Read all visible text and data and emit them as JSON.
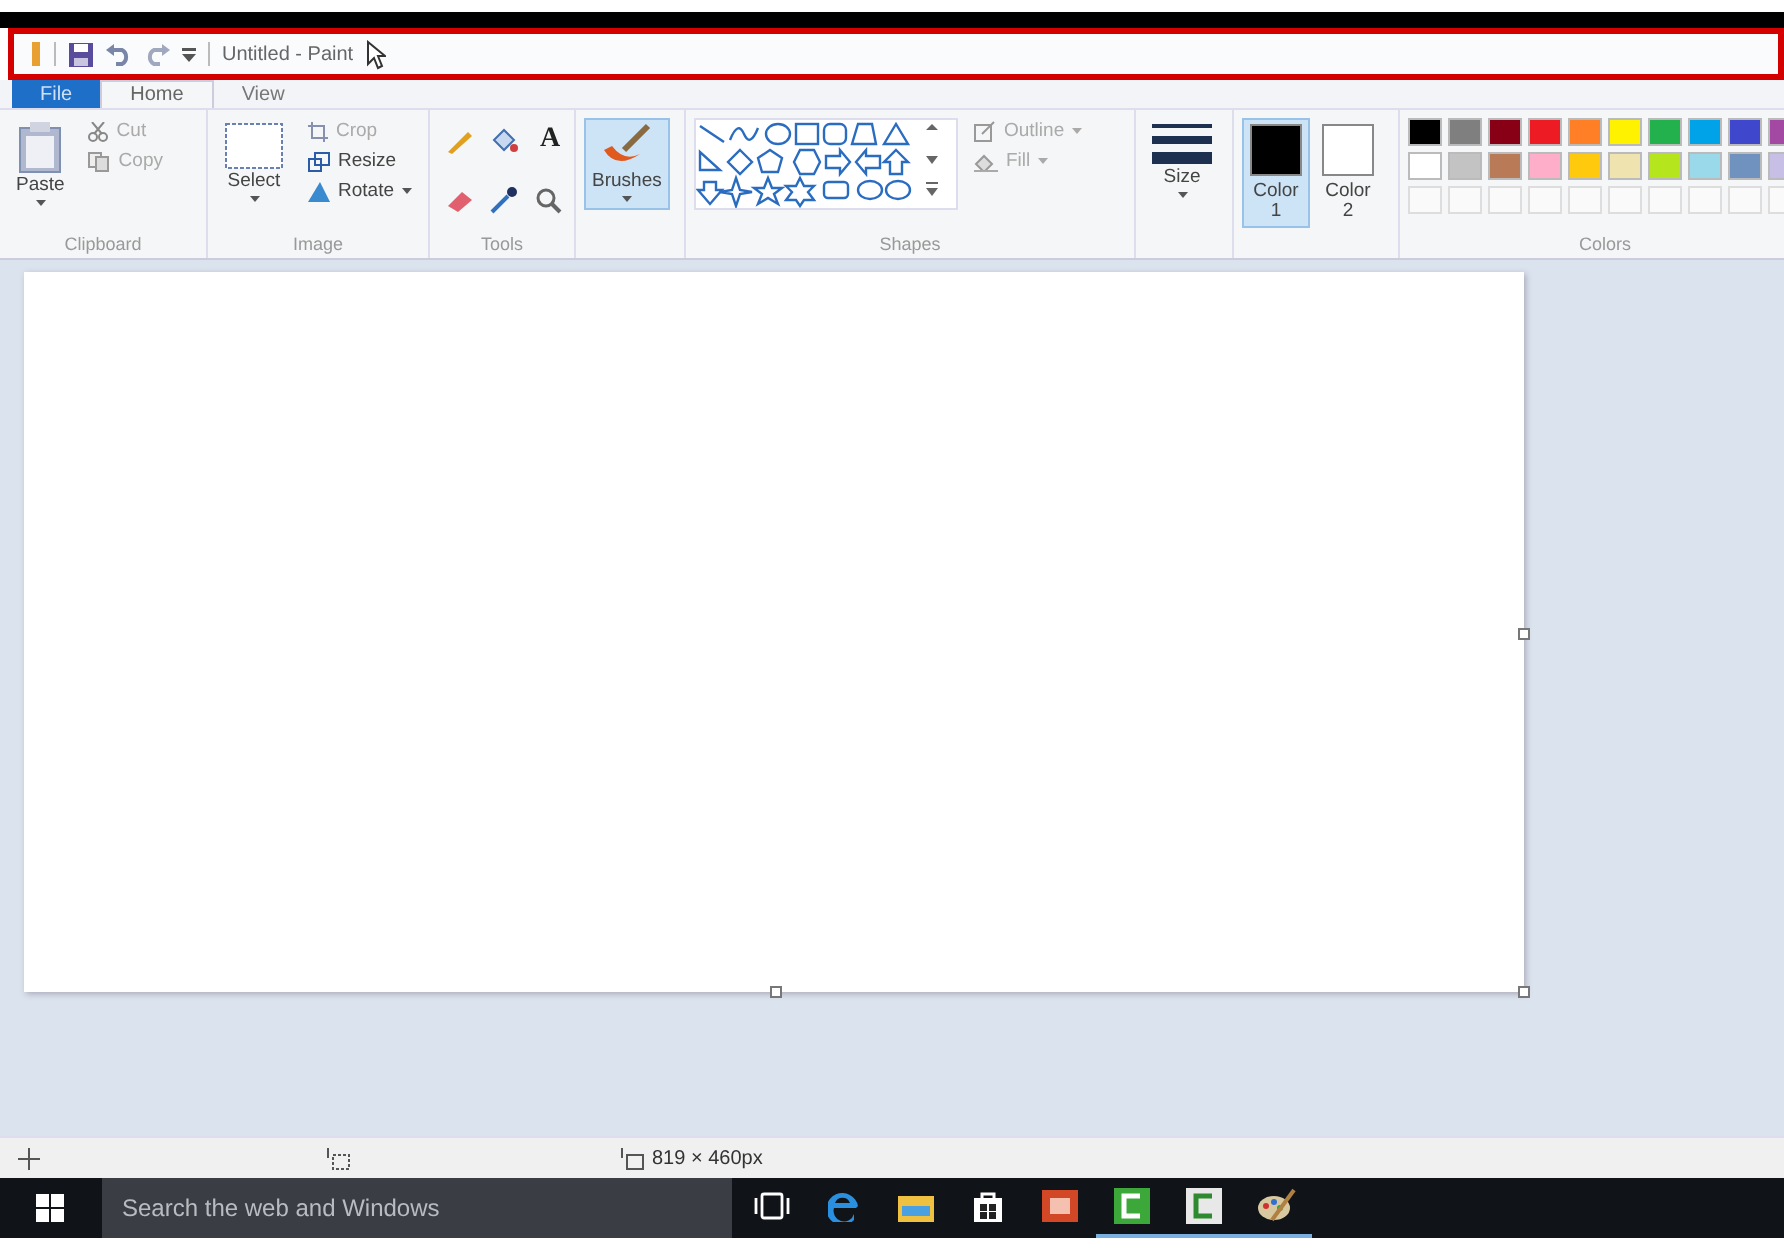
{
  "title_bar": {
    "title": "Untitled - Paint",
    "highlighted": true
  },
  "tabs": [
    {
      "label": "File",
      "selected": false,
      "kind": "file"
    },
    {
      "label": "Home",
      "selected": true,
      "kind": "tab"
    },
    {
      "label": "View",
      "selected": false,
      "kind": "tab"
    }
  ],
  "ribbon": {
    "clipboard": {
      "label": "Clipboard",
      "paste": "Paste",
      "cut": {
        "label": "Cut",
        "disabled": true
      },
      "copy": {
        "label": "Copy",
        "disabled": true
      }
    },
    "image": {
      "label": "Image",
      "select": "Select",
      "crop": {
        "label": "Crop",
        "disabled": true
      },
      "resize": {
        "label": "Resize",
        "disabled": false
      },
      "rotate": {
        "label": "Rotate",
        "disabled": false
      }
    },
    "tools": {
      "label": "Tools",
      "text_tool": "A"
    },
    "brushes": {
      "label": "Brushes",
      "selected": true
    },
    "shapes": {
      "label": "Shapes",
      "outline": {
        "label": "Outline",
        "disabled": true
      },
      "fill": {
        "label": "Fill",
        "disabled": true
      }
    },
    "size": {
      "label": "Size"
    },
    "color_slots": [
      {
        "label": "Color",
        "number": "1",
        "color": "#000000",
        "selected": true
      },
      {
        "label": "Color",
        "number": "2",
        "color": "#ffffff",
        "selected": false
      }
    ],
    "colors": {
      "label": "Colors",
      "swatches": [
        {
          "color": "#000000"
        },
        {
          "color": "#7f7f7f"
        },
        {
          "color": "#880015"
        },
        {
          "color": "#ed1c24"
        },
        {
          "color": "#ff7f27"
        },
        {
          "color": "#fff200"
        },
        {
          "color": "#22b14c"
        },
        {
          "color": "#00a2e8"
        },
        {
          "color": "#3f48cc"
        },
        {
          "color": "#a349a4"
        },
        {
          "color": "#ffffff"
        },
        {
          "color": "#c3c3c3"
        },
        {
          "color": "#b97a57"
        },
        {
          "color": "#ffaec9"
        },
        {
          "color": "#ffc90e"
        },
        {
          "color": "#efe4b0"
        },
        {
          "color": "#b5e61d"
        },
        {
          "color": "#99d9ea"
        },
        {
          "color": "#7092be"
        },
        {
          "color": "#c8bfe7"
        }
      ]
    }
  },
  "status_bar": {
    "canvas_size": "819 × 460px"
  },
  "taskbar": {
    "search_placeholder": "Search the web and Windows",
    "apps": [
      {
        "kind": "taskview",
        "running": false
      },
      {
        "kind": "edge",
        "running": false
      },
      {
        "kind": "explorer",
        "running": false
      },
      {
        "kind": "store",
        "running": false
      },
      {
        "kind": "powerpoint",
        "running": false
      },
      {
        "kind": "recorder",
        "running": true
      },
      {
        "kind": "editor",
        "running": true
      },
      {
        "kind": "paint",
        "running": true
      }
    ]
  }
}
